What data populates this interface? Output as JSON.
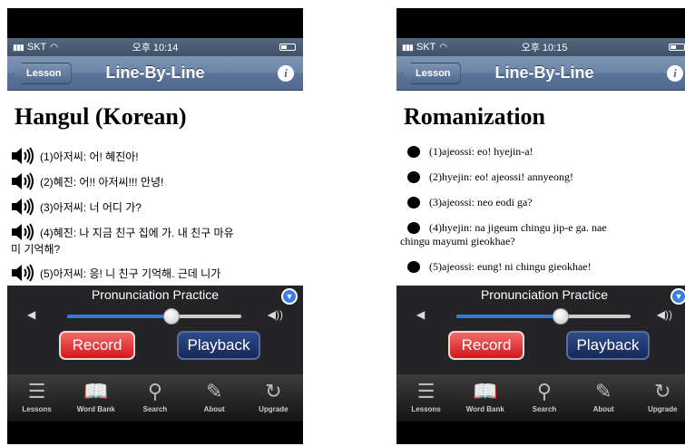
{
  "screens": [
    {
      "status": {
        "carrier": "SKT",
        "time": "오후 10:14"
      },
      "nav": {
        "back": "Lesson",
        "title": "Line-By-Line",
        "info": "i"
      },
      "heading": "Hangul (Korean)",
      "lines": [
        {
          "num": "(1)",
          "text": "아저씨: 어! 혜진아!"
        },
        {
          "num": "(2)",
          "text": "혜진: 어!! 아저씨!!! 안녕!"
        },
        {
          "num": "(3)",
          "text": "아저씨: 너 어디 가?"
        },
        {
          "num": "(4)",
          "text": "혜진: 나 지금 친구 집에 가. 내 친구 마유",
          "cont": "미 기억해?"
        },
        {
          "num": "(5)",
          "text": "아저씨: 응! 니 친구 기억해. 근데 니가"
        }
      ],
      "practice": {
        "title": "Pronunciation Practice",
        "volume": 0.6,
        "record": "Record",
        "playback": "Playback"
      },
      "tabs": [
        {
          "icon": "lessons-icon",
          "label": "Lessons"
        },
        {
          "icon": "word-bank-icon",
          "label": "Word Bank"
        },
        {
          "icon": "search-icon",
          "label": "Search"
        },
        {
          "icon": "about-icon",
          "label": "About"
        },
        {
          "icon": "upgrade-icon",
          "label": "Upgrade"
        }
      ]
    },
    {
      "status": {
        "carrier": "SKT",
        "time": "오후 10:15"
      },
      "nav": {
        "back": "Lesson",
        "title": "Line-By-Line",
        "info": "i"
      },
      "heading": "Romanization",
      "lines": [
        {
          "text": "(1)ajeossi: eo! hyejin-a!"
        },
        {
          "text": "(2)hyejin: eo! ajeossi! annyeong!"
        },
        {
          "text": "(3)ajeossi: neo eodi ga?"
        },
        {
          "text": "(4)hyejin: na jigeum chingu jip-e ga. nae",
          "cont": "chingu mayumi gieokhae?"
        },
        {
          "text": "(5)ajeossi: eung! ni chingu gieokhae!"
        }
      ],
      "practice": {
        "title": "Pronunciation Practice",
        "volume": 0.6,
        "record": "Record",
        "playback": "Playback"
      },
      "tabs": [
        {
          "icon": "lessons-icon",
          "label": "Lessons"
        },
        {
          "icon": "word-bank-icon",
          "label": "Word Bank"
        },
        {
          "icon": "search-icon",
          "label": "Search"
        },
        {
          "icon": "about-icon",
          "label": "About"
        },
        {
          "icon": "upgrade-icon",
          "label": "Upgrade"
        }
      ]
    }
  ]
}
